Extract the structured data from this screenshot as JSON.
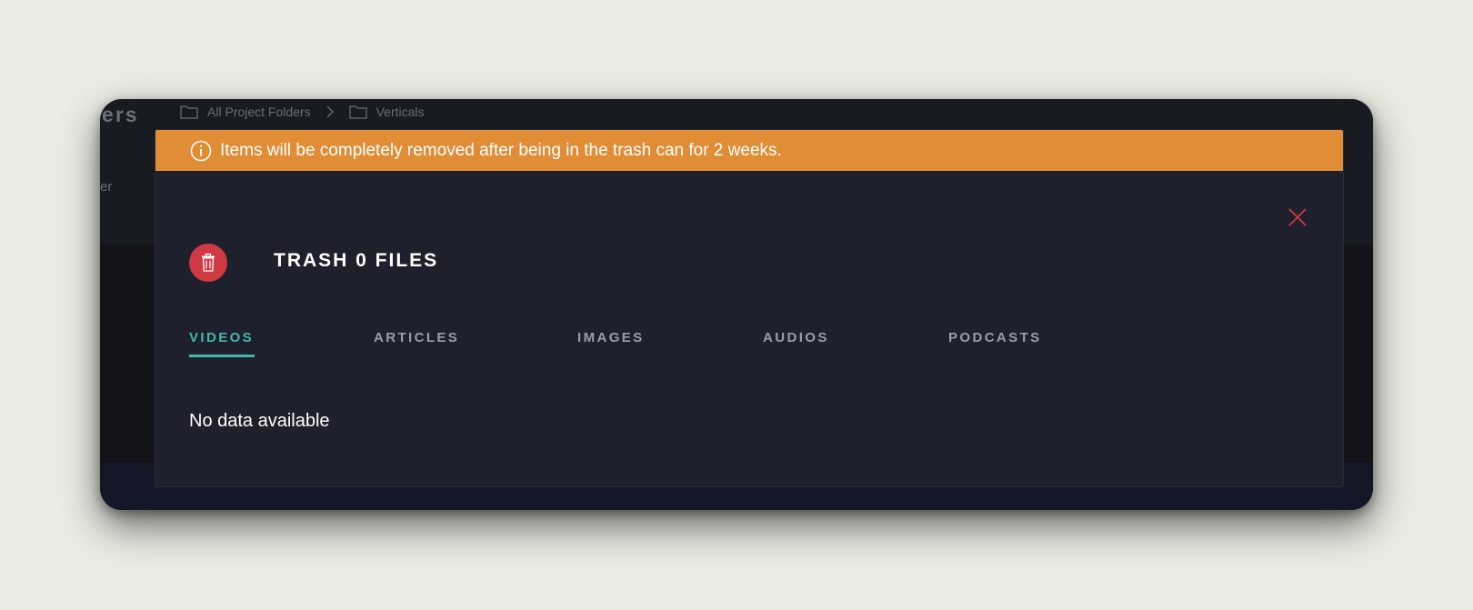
{
  "background": {
    "page_title": "ders",
    "sidebar_text": "er",
    "breadcrumb": [
      "All Project Folders",
      "Verticals"
    ]
  },
  "banner": {
    "message": "Items will be completely removed after being in the trash can for 2 weeks.",
    "icon": "info-icon",
    "color": "#e08d36"
  },
  "modal": {
    "title": "TRASH 0 FILES",
    "close_icon": "close-icon",
    "trash_icon": "trash-icon",
    "tabs": [
      "VIDEOS",
      "ARTICLES",
      "IMAGES",
      "AUDIOS",
      "PODCASTS"
    ],
    "active_tab": "VIDEOS",
    "empty_message": "No data available",
    "accent_color": "#45b7a9",
    "danger_color": "#cf3a43"
  }
}
